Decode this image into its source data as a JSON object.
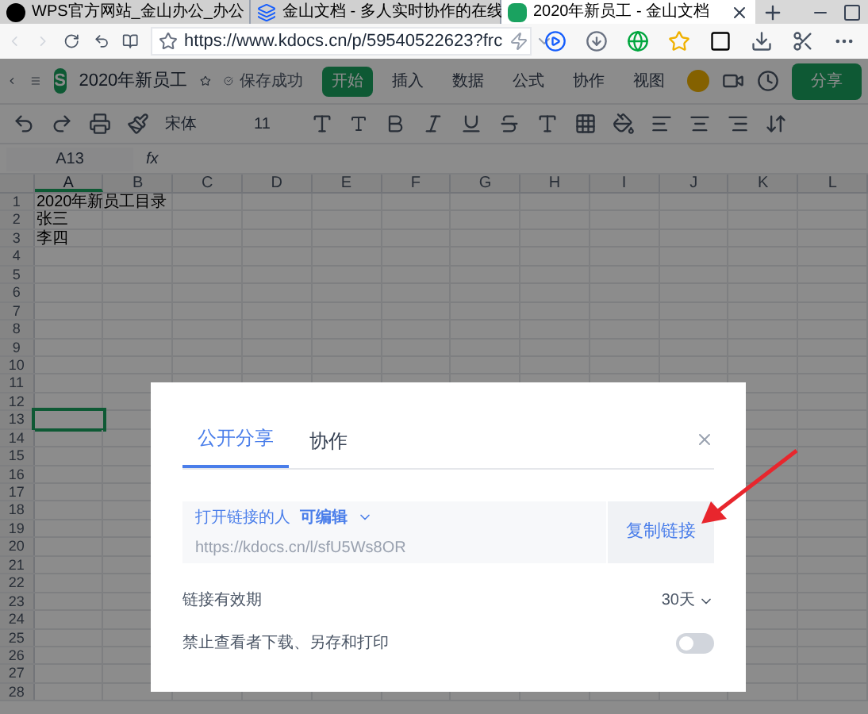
{
  "browser": {
    "tabs": [
      {
        "title": "WPS官方网站_金山办公_办公",
        "selected": false,
        "kind": "wps"
      },
      {
        "title": "金山文档 - 多人实时协作的在线",
        "selected": false,
        "kind": "docs"
      },
      {
        "title": "2020年新员工 - 金山文档",
        "selected": true,
        "kind": "sheet"
      }
    ],
    "url": "https://www.kdocs.cn/p/59540522623?frc"
  },
  "app": {
    "logo_letter": "S",
    "doc_title": "2020年新员工",
    "save_status": "保存成功",
    "menu": [
      {
        "label": "开始",
        "selected": true
      },
      {
        "label": "插入",
        "selected": false
      },
      {
        "label": "数据",
        "selected": false
      },
      {
        "label": "公式",
        "selected": false
      },
      {
        "label": "协作",
        "selected": false
      },
      {
        "label": "视图",
        "selected": false
      }
    ],
    "share_button": "分享"
  },
  "format_toolbar": {
    "font": "宋体",
    "size": "11"
  },
  "formula_bar": {
    "cell_ref": "A13",
    "fx": "fx"
  },
  "sheet": {
    "columns": [
      {
        "label": "A",
        "selected": true
      },
      {
        "label": "B",
        "selected": false
      },
      {
        "label": "C",
        "selected": false
      },
      {
        "label": "D",
        "selected": false
      },
      {
        "label": "E",
        "selected": false
      },
      {
        "label": "F",
        "selected": false
      },
      {
        "label": "G",
        "selected": false
      },
      {
        "label": "H",
        "selected": false
      },
      {
        "label": "I",
        "selected": false
      },
      {
        "label": "J",
        "selected": false
      },
      {
        "label": "K",
        "selected": false
      },
      {
        "label": "L",
        "selected": false
      }
    ],
    "rows": [
      {
        "label": "1",
        "cell_a": "2020年新员工目录",
        "selected": false
      },
      {
        "label": "2",
        "cell_a": "张三",
        "selected": false
      },
      {
        "label": "3",
        "cell_a": "李四",
        "selected": false
      },
      {
        "label": "4",
        "selected": false
      },
      {
        "label": "5",
        "selected": false
      },
      {
        "label": "6",
        "selected": false
      },
      {
        "label": "7",
        "selected": false
      },
      {
        "label": "8",
        "selected": false
      },
      {
        "label": "9",
        "selected": false
      },
      {
        "label": "10",
        "selected": false
      },
      {
        "label": "11",
        "selected": false
      },
      {
        "label": "12",
        "selected": false
      },
      {
        "label": "13",
        "selected": true
      },
      {
        "label": "14",
        "selected": false
      },
      {
        "label": "15",
        "selected": false
      },
      {
        "label": "16",
        "selected": false
      },
      {
        "label": "17",
        "selected": false
      },
      {
        "label": "18",
        "selected": false
      },
      {
        "label": "19",
        "selected": false
      },
      {
        "label": "20",
        "selected": false
      },
      {
        "label": "21",
        "selected": false
      },
      {
        "label": "22",
        "selected": false
      },
      {
        "label": "23",
        "selected": false
      },
      {
        "label": "24",
        "selected": false
      },
      {
        "label": "25",
        "selected": false
      },
      {
        "label": "26",
        "selected": false
      },
      {
        "label": "27",
        "selected": false
      },
      {
        "label": "28",
        "selected": false
      }
    ]
  },
  "share_dialog": {
    "tabs": [
      {
        "label": "公开分享",
        "selected": true
      },
      {
        "label": "协作",
        "selected": false
      }
    ],
    "link": {
      "audience": "打开链接的人",
      "permission": "可编辑",
      "url": "https://kdocs.cn/l/sfU5Ws8OR",
      "copy_button": "复制链接"
    },
    "expiry": {
      "label": "链接有效期",
      "value": "30天"
    },
    "restrict": {
      "label": "禁止查看者下载、另存和打印",
      "on": false
    }
  }
}
